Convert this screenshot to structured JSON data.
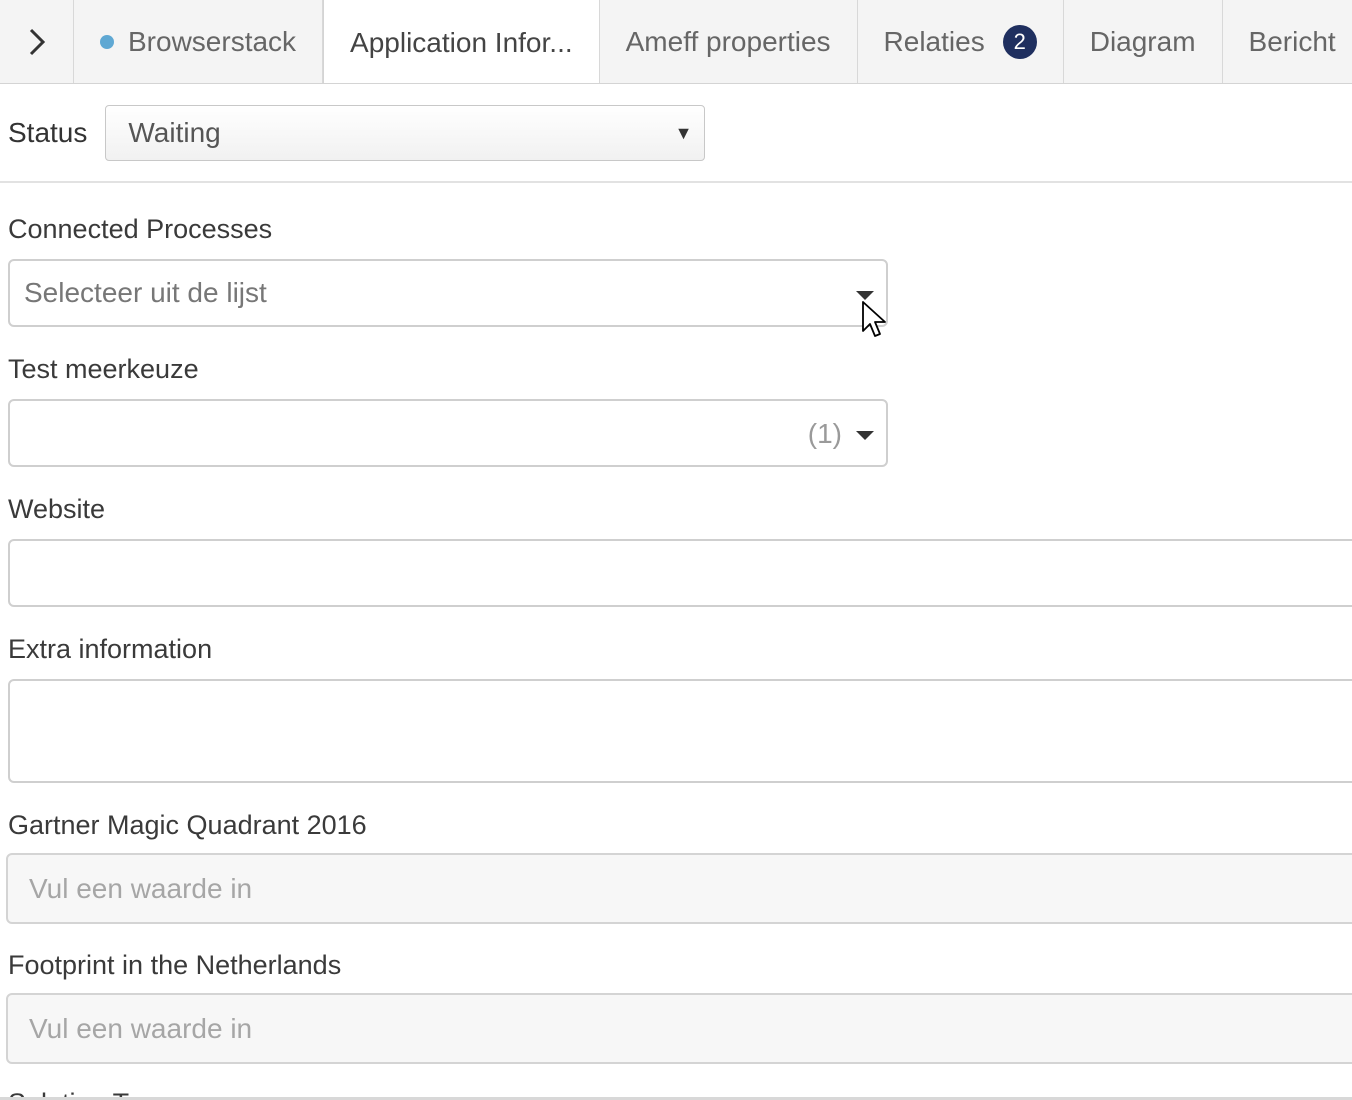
{
  "tabs": [
    {
      "label": "Browserstack",
      "dot_color": "#5fa8d3"
    },
    {
      "label": "Application Infor..."
    },
    {
      "label": "Ameff properties"
    },
    {
      "label": "Relaties",
      "badge": "2"
    },
    {
      "label": "Diagram"
    },
    {
      "label": "Bericht"
    }
  ],
  "active_tab": "Application Infor...",
  "status": {
    "label": "Status",
    "value": "Waiting"
  },
  "fields": {
    "connected_processes": {
      "label": "Connected Processes",
      "placeholder": "Selecteer uit de lijst"
    },
    "test_meerkeuze": {
      "label": "Test meerkeuze",
      "count": "(1)"
    },
    "website": {
      "label": "Website",
      "value": ""
    },
    "extra_information": {
      "label": "Extra information",
      "value": ""
    },
    "gartner": {
      "label": "Gartner Magic Quadrant 2016",
      "placeholder": "Vul een waarde in"
    },
    "footprint": {
      "label": "Footprint in the Netherlands",
      "placeholder": "Vul een waarde in"
    },
    "solution_type": {
      "label": "Solution Type"
    }
  },
  "icons": {
    "expand": "chevron-right-icon",
    "dropdown": "caret-down-icon",
    "cursor": "mouse-pointer-icon"
  },
  "colors": {
    "badge": "#1f2f5f",
    "dot": "#5fa8d3",
    "tab_bar": "#f4f4f4"
  }
}
